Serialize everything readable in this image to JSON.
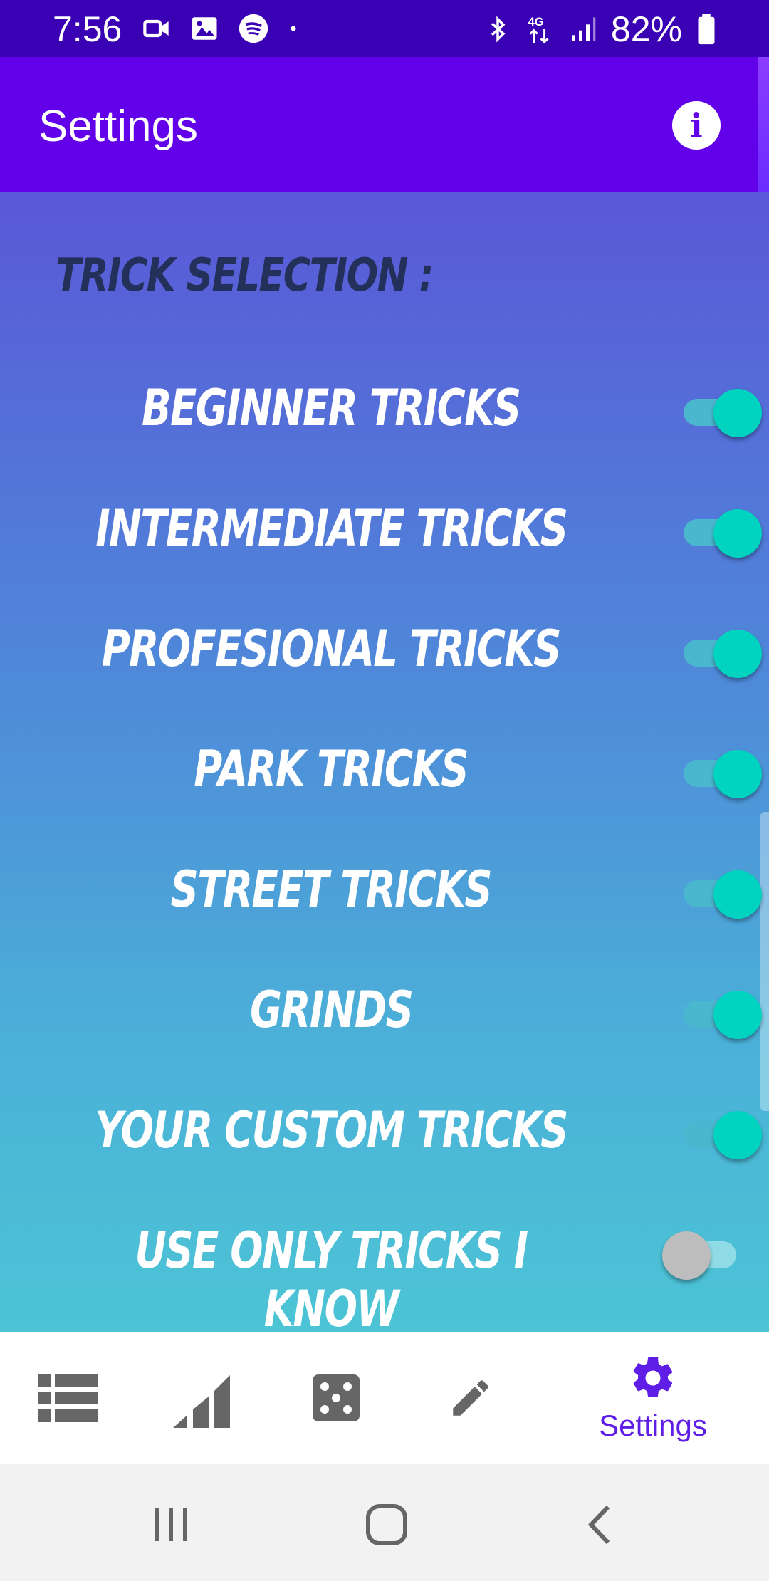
{
  "status_bar": {
    "time": "7:56",
    "battery": "82%",
    "left_icons": [
      "video-icon",
      "image-icon",
      "spotify-icon",
      "dot-icon"
    ],
    "right_icons": [
      "bluetooth-icon",
      "4g-icon",
      "signal-icon",
      "battery-icon"
    ]
  },
  "app_bar": {
    "title": "Settings",
    "info_glyph": "i"
  },
  "section": {
    "title": "TRICK SELECTION :"
  },
  "toggles": [
    {
      "label": "BEGINNER TRICKS",
      "on": true
    },
    {
      "label": "INTERMEDIATE TRICKS",
      "on": true
    },
    {
      "label": "PROFESIONAL TRICKS",
      "on": true
    },
    {
      "label": "PARK TRICKS",
      "on": true
    },
    {
      "label": "STREET TRICKS",
      "on": true
    },
    {
      "label": "GRINDS",
      "on": true
    },
    {
      "label": "YOUR CUSTOM TRICKS",
      "on": true
    },
    {
      "label": "USE ONLY TRICKS I KNOW",
      "on": false
    }
  ],
  "bottom_nav": {
    "items": [
      {
        "icon": "list-icon"
      },
      {
        "icon": "stats-icon"
      },
      {
        "icon": "dice-icon"
      },
      {
        "icon": "pencil-icon"
      },
      {
        "icon": "gear-icon",
        "label": "Settings",
        "active": true
      }
    ]
  },
  "colors": {
    "status_bar": "#3a00b3",
    "app_bar": "#6200ea",
    "accent": "#00d4c0",
    "nav_active": "#5e1ee6"
  }
}
